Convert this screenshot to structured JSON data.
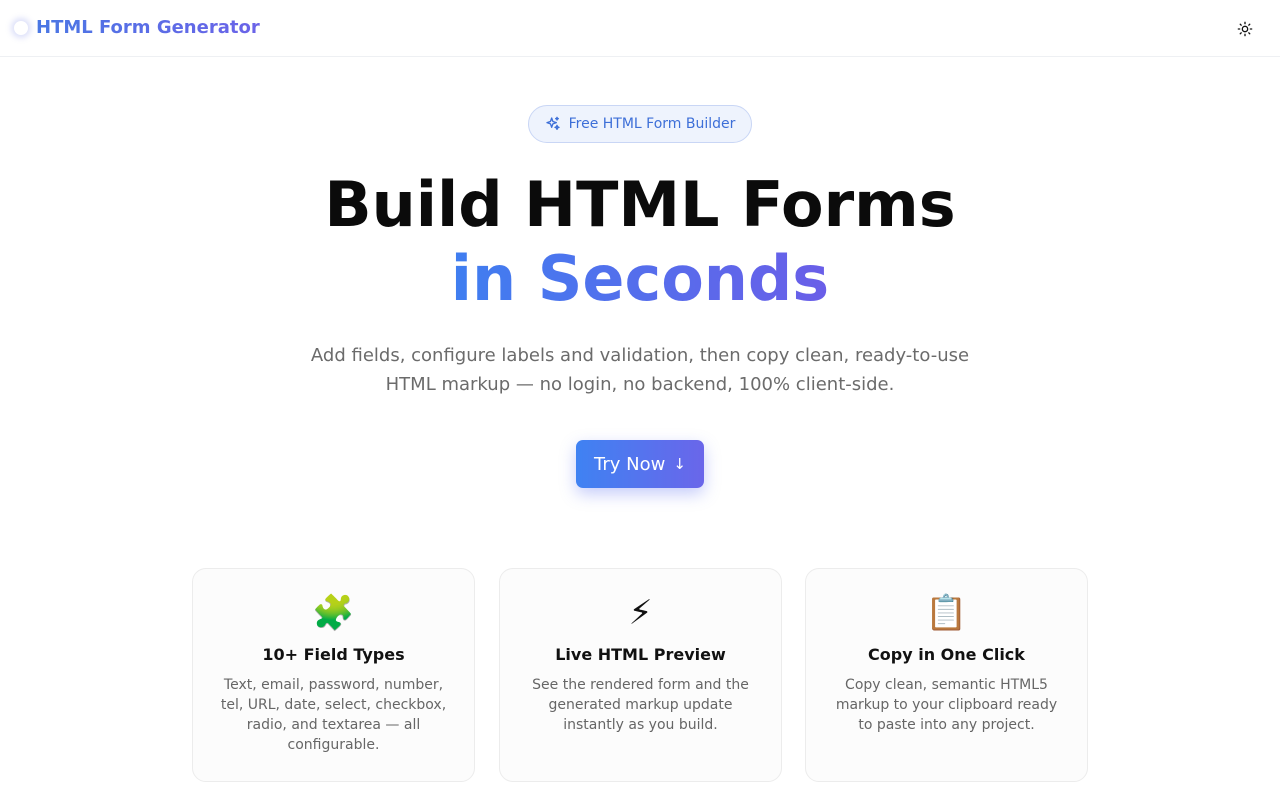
{
  "header": {
    "app_name": "HTML Form Generator",
    "theme_icon": "sun-icon"
  },
  "hero": {
    "badge": "Free HTML Form Builder",
    "badge_icon": "sparkles-icon",
    "title_line1": "Build HTML Forms",
    "title_line2": "in Seconds",
    "subtitle": "Add fields, configure labels and validation, then copy clean, ready-to-use HTML markup — no login, no backend, 100% client-side.",
    "cta_label": "Try Now",
    "cta_icon": "arrow-down-icon"
  },
  "features": [
    {
      "icon": "🧩",
      "icon_name": "puzzle-icon",
      "title": "10+ Field Types",
      "desc": "Text, email, password, number, tel, URL, date, select, checkbox, radio, and textarea — all configurable."
    },
    {
      "icon": "⚡",
      "icon_name": "lightning-icon",
      "title": "Live HTML Preview",
      "desc": "See the rendered form and the generated markup update instantly as you build."
    },
    {
      "icon": "📋",
      "icon_name": "clipboard-icon",
      "title": "Copy in One Click",
      "desc": "Copy clean, semantic HTML5 markup to your clipboard ready to paste into any project."
    }
  ],
  "colors": {
    "accent_start": "#3f7ef0",
    "accent_end": "#6a5ee8"
  }
}
